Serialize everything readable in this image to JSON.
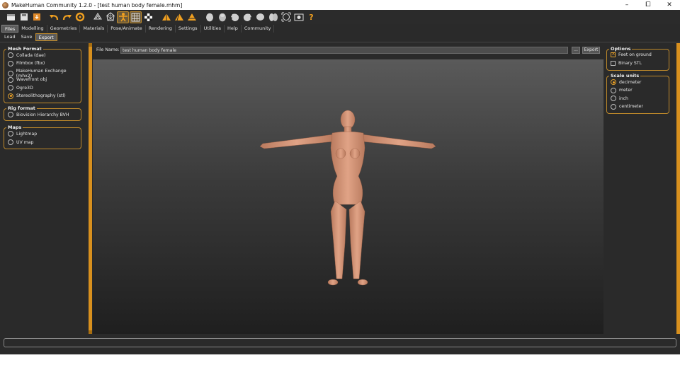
{
  "window": {
    "title": "MakeHuman Community 1.2.0 - [test human body female.mhm]",
    "controls": {
      "minimize": "–",
      "maximize": "⧠",
      "close": "✕"
    }
  },
  "toolbar": {
    "icons": [
      "file-new-icon",
      "save-icon",
      "export-icon",
      "undo-icon",
      "redo-icon",
      "reset-icon",
      "smooth-icon",
      "wireframe-icon",
      "pose-icon",
      "grid-icon",
      "background-icon",
      "front-view-icon",
      "side-view-icon",
      "top-view-icon",
      "head-front-icon",
      "head-back-icon",
      "head-left-icon",
      "head-right-icon",
      "head-top-icon",
      "head-bottom-icon",
      "reset-camera-icon",
      "screenshot-icon",
      "help-icon"
    ],
    "help_label": "?"
  },
  "main_tabs": [
    {
      "label": "Files",
      "active": true
    },
    {
      "label": "Modelling",
      "active": false
    },
    {
      "label": "Geometries",
      "active": false
    },
    {
      "label": "Materials",
      "active": false
    },
    {
      "label": "Pose/Animate",
      "active": false
    },
    {
      "label": "Rendering",
      "active": false
    },
    {
      "label": "Settings",
      "active": false
    },
    {
      "label": "Utilities",
      "active": false
    },
    {
      "label": "Help",
      "active": false
    },
    {
      "label": "Community",
      "active": false
    }
  ],
  "sub_tabs": [
    {
      "label": "Load",
      "active": false
    },
    {
      "label": "Save",
      "active": false
    },
    {
      "label": "Export",
      "active": true
    }
  ],
  "left_panel": {
    "mesh_format": {
      "title": "Mesh Format",
      "options": [
        {
          "label": "Collada (dae)",
          "selected": false
        },
        {
          "label": "Filmbox (fbx)",
          "selected": false
        },
        {
          "label": "MakeHuman Exchange (mhx2)",
          "selected": false
        },
        {
          "label": "Wavefront obj",
          "selected": false
        },
        {
          "label": "Ogre3D",
          "selected": false
        },
        {
          "label": "Stereolithography (stl)",
          "selected": true
        }
      ]
    },
    "rig_format": {
      "title": "Rig format",
      "options": [
        {
          "label": "Biovision Hierarchy BVH",
          "selected": false
        }
      ]
    },
    "maps": {
      "title": "Maps",
      "options": [
        {
          "label": "Lightmap",
          "selected": false
        },
        {
          "label": "UV map",
          "selected": false
        }
      ]
    }
  },
  "export_bar": {
    "file_name_label": "File Name:",
    "file_name_value": "test human body female",
    "browse_label": "...",
    "export_label": "Export"
  },
  "right_panel": {
    "options": {
      "title": "Options",
      "items": [
        {
          "label": "Feet on ground",
          "checked": true
        },
        {
          "label": "Binary STL",
          "checked": false
        }
      ]
    },
    "scale_units": {
      "title": "Scale units",
      "options": [
        {
          "label": "decimeter",
          "selected": true
        },
        {
          "label": "meter",
          "selected": false
        },
        {
          "label": "inch",
          "selected": false
        },
        {
          "label": "centimeter",
          "selected": false
        }
      ]
    }
  },
  "status_bar": {
    "text": ""
  },
  "colors": {
    "accent": "#d8901e",
    "background": "#2a2a2a",
    "skin": "#d99a7e"
  }
}
